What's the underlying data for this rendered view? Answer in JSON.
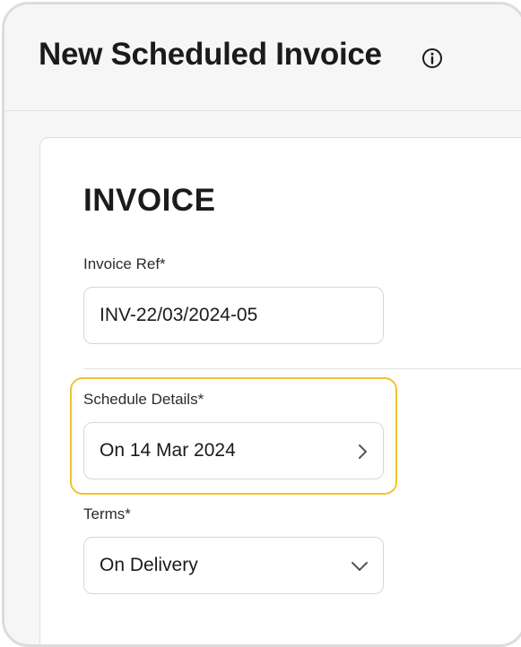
{
  "header": {
    "title": "New Scheduled Invoice",
    "info_icon": "info-circle-icon"
  },
  "form": {
    "section_title": "INVOICE",
    "invoice_ref": {
      "label": "Invoice Ref*",
      "value": "INV-22/03/2024-05"
    },
    "schedule_details": {
      "label": "Schedule Details*",
      "value": "On 14 Mar 2024",
      "icon": "chevron-right-icon"
    },
    "terms": {
      "label": "Terms*",
      "value": "On Delivery",
      "icon": "chevron-down-icon"
    }
  },
  "colors": {
    "highlight": "#f2c230",
    "text": "#1b1b1b",
    "background": "#f6f6f6"
  }
}
